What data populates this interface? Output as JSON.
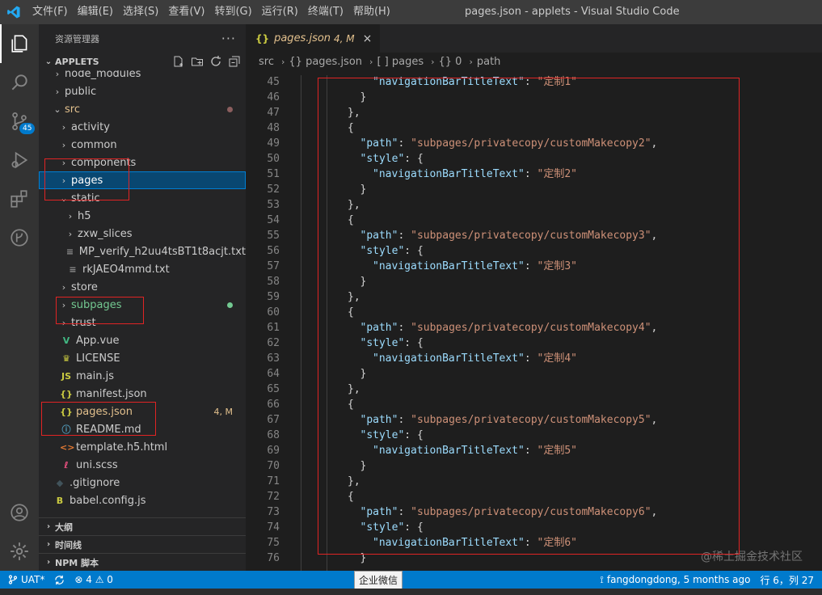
{
  "titlebar": {
    "menu": [
      "文件(F)",
      "编辑(E)",
      "选择(S)",
      "查看(V)",
      "转到(G)",
      "运行(R)",
      "终端(T)",
      "帮助(H)"
    ],
    "window_title": "pages.json - applets - Visual Studio Code"
  },
  "activitybar": {
    "scm_badge": "45"
  },
  "sidebar": {
    "title": "资源管理器",
    "more": "···",
    "project": "APPLETS",
    "tree": [
      {
        "label": "node_modules",
        "twist": "›",
        "icon": "",
        "depth": 1,
        "color": "#cccccc"
      },
      {
        "label": "public",
        "twist": "›",
        "icon": "",
        "depth": 1,
        "color": "#cccccc"
      },
      {
        "label": "src",
        "twist": "⌄",
        "icon": "",
        "depth": 1,
        "color": "#e2c08d",
        "dot": "#8b5e5e"
      },
      {
        "label": "activity",
        "twist": "›",
        "icon": "",
        "depth": 2,
        "color": "#cccccc"
      },
      {
        "label": "common",
        "twist": "›",
        "icon": "",
        "depth": 2,
        "color": "#cccccc"
      },
      {
        "label": "components",
        "twist": "›",
        "icon": "",
        "depth": 2,
        "color": "#cccccc"
      },
      {
        "label": "pages",
        "twist": "›",
        "icon": "",
        "depth": 2,
        "color": "#ffffff",
        "selected": true
      },
      {
        "label": "static",
        "twist": "⌄",
        "icon": "",
        "depth": 2,
        "color": "#cccccc"
      },
      {
        "label": "h5",
        "twist": "›",
        "icon": "",
        "depth": 3,
        "color": "#cccccc"
      },
      {
        "label": "zxw_slices",
        "twist": "›",
        "icon": "",
        "depth": 3,
        "color": "#cccccc"
      },
      {
        "label": "MP_verify_h2uu4tsBT1t8acjt.txt",
        "twist": "",
        "icon": "≡",
        "depth": 3,
        "color": "#cccccc",
        "icolor": "#8f8f8f"
      },
      {
        "label": "rkJAEO4mmd.txt",
        "twist": "",
        "icon": "≡",
        "depth": 3,
        "color": "#cccccc",
        "icolor": "#8f8f8f"
      },
      {
        "label": "store",
        "twist": "›",
        "icon": "",
        "depth": 2,
        "color": "#cccccc"
      },
      {
        "label": "subpages",
        "twist": "›",
        "icon": "",
        "depth": 2,
        "color": "#73c991",
        "dot": "#73c991"
      },
      {
        "label": "trust",
        "twist": "›",
        "icon": "",
        "depth": 2,
        "color": "#cccccc"
      },
      {
        "label": "App.vue",
        "twist": "",
        "icon": "V",
        "depth": 2,
        "color": "#cccccc",
        "icolor": "#41b883"
      },
      {
        "label": "LICENSE",
        "twist": "",
        "icon": "♛",
        "depth": 2,
        "color": "#cccccc",
        "icolor": "#cbcb41"
      },
      {
        "label": "main.js",
        "twist": "",
        "icon": "JS",
        "depth": 2,
        "color": "#cccccc",
        "icolor": "#cbcb41"
      },
      {
        "label": "manifest.json",
        "twist": "",
        "icon": "{}",
        "depth": 2,
        "color": "#cccccc",
        "icolor": "#cbcb41"
      },
      {
        "label": "pages.json",
        "twist": "",
        "icon": "{}",
        "depth": 2,
        "color": "#e2c08d",
        "icolor": "#cbcb41",
        "status": "4, M"
      },
      {
        "label": "README.md",
        "twist": "",
        "icon": "ⓘ",
        "depth": 2,
        "color": "#cccccc",
        "icolor": "#519aba"
      },
      {
        "label": "template.h5.html",
        "twist": "",
        "icon": "<>",
        "depth": 2,
        "color": "#cccccc",
        "icolor": "#e37933"
      },
      {
        "label": "uni.scss",
        "twist": "",
        "icon": "ℓ",
        "depth": 2,
        "color": "#cccccc",
        "icolor": "#f55385"
      },
      {
        "label": ".gitignore",
        "twist": "",
        "icon": "◆",
        "depth": 1,
        "color": "#cccccc",
        "icolor": "#41535b"
      },
      {
        "label": "babel.config.js",
        "twist": "",
        "icon": "B",
        "depth": 1,
        "color": "#cccccc",
        "icolor": "#cbcb41"
      }
    ],
    "bottom_sections": [
      "大纲",
      "时间线",
      "NPM 脚本"
    ]
  },
  "editor": {
    "tab": {
      "icon": "{}",
      "name": "pages.json",
      "mod": "4, M",
      "close": "×"
    },
    "breadcrumb": [
      "src",
      "{} pages.json",
      "[ ] pages",
      "{} 0",
      "path"
    ],
    "lines": [
      {
        "n": "45",
        "indent": 6,
        "parts": [
          [
            "k",
            "\"navigationBarTitleText\""
          ],
          [
            "p",
            ": "
          ],
          [
            "s",
            "\"定制1\""
          ]
        ]
      },
      {
        "n": "46",
        "indent": 5,
        "parts": [
          [
            "p",
            "}"
          ]
        ]
      },
      {
        "n": "47",
        "indent": 4,
        "parts": [
          [
            "p",
            "},"
          ]
        ]
      },
      {
        "n": "48",
        "indent": 4,
        "parts": [
          [
            "p",
            "{"
          ]
        ]
      },
      {
        "n": "49",
        "indent": 5,
        "parts": [
          [
            "k",
            "\"path\""
          ],
          [
            "p",
            ": "
          ],
          [
            "s",
            "\"subpages/privatecopy/customMakecopy2\""
          ],
          [
            "p",
            ","
          ]
        ]
      },
      {
        "n": "50",
        "indent": 5,
        "parts": [
          [
            "k",
            "\"style\""
          ],
          [
            "p",
            ": {"
          ]
        ]
      },
      {
        "n": "51",
        "indent": 6,
        "parts": [
          [
            "k",
            "\"navigationBarTitleText\""
          ],
          [
            "p",
            ": "
          ],
          [
            "s",
            "\"定制2\""
          ]
        ]
      },
      {
        "n": "52",
        "indent": 5,
        "parts": [
          [
            "p",
            "}"
          ]
        ]
      },
      {
        "n": "53",
        "indent": 4,
        "parts": [
          [
            "p",
            "},"
          ]
        ]
      },
      {
        "n": "54",
        "indent": 4,
        "parts": [
          [
            "p",
            "{"
          ]
        ]
      },
      {
        "n": "55",
        "indent": 5,
        "parts": [
          [
            "k",
            "\"path\""
          ],
          [
            "p",
            ": "
          ],
          [
            "s",
            "\"subpages/privatecopy/customMakecopy3\""
          ],
          [
            "p",
            ","
          ]
        ]
      },
      {
        "n": "56",
        "indent": 5,
        "parts": [
          [
            "k",
            "\"style\""
          ],
          [
            "p",
            ": {"
          ]
        ]
      },
      {
        "n": "57",
        "indent": 6,
        "parts": [
          [
            "k",
            "\"navigationBarTitleText\""
          ],
          [
            "p",
            ": "
          ],
          [
            "s",
            "\"定制3\""
          ]
        ]
      },
      {
        "n": "58",
        "indent": 5,
        "parts": [
          [
            "p",
            "}"
          ]
        ]
      },
      {
        "n": "59",
        "indent": 4,
        "parts": [
          [
            "p",
            "},"
          ]
        ]
      },
      {
        "n": "60",
        "indent": 4,
        "parts": [
          [
            "p",
            "{"
          ]
        ]
      },
      {
        "n": "61",
        "indent": 5,
        "parts": [
          [
            "k",
            "\"path\""
          ],
          [
            "p",
            ": "
          ],
          [
            "s",
            "\"subpages/privatecopy/customMakecopy4\""
          ],
          [
            "p",
            ","
          ]
        ]
      },
      {
        "n": "62",
        "indent": 5,
        "parts": [
          [
            "k",
            "\"style\""
          ],
          [
            "p",
            ": {"
          ]
        ]
      },
      {
        "n": "63",
        "indent": 6,
        "parts": [
          [
            "k",
            "\"navigationBarTitleText\""
          ],
          [
            "p",
            ": "
          ],
          [
            "s",
            "\"定制4\""
          ]
        ]
      },
      {
        "n": "64",
        "indent": 5,
        "parts": [
          [
            "p",
            "}"
          ]
        ]
      },
      {
        "n": "65",
        "indent": 4,
        "parts": [
          [
            "p",
            "},"
          ]
        ]
      },
      {
        "n": "66",
        "indent": 4,
        "parts": [
          [
            "p",
            "{"
          ]
        ]
      },
      {
        "n": "67",
        "indent": 5,
        "parts": [
          [
            "k",
            "\"path\""
          ],
          [
            "p",
            ": "
          ],
          [
            "s",
            "\"subpages/privatecopy/customMakecopy5\""
          ],
          [
            "p",
            ","
          ]
        ]
      },
      {
        "n": "68",
        "indent": 5,
        "parts": [
          [
            "k",
            "\"style\""
          ],
          [
            "p",
            ": {"
          ]
        ]
      },
      {
        "n": "69",
        "indent": 6,
        "parts": [
          [
            "k",
            "\"navigationBarTitleText\""
          ],
          [
            "p",
            ": "
          ],
          [
            "s",
            "\"定制5\""
          ]
        ]
      },
      {
        "n": "70",
        "indent": 5,
        "parts": [
          [
            "p",
            "}"
          ]
        ]
      },
      {
        "n": "71",
        "indent": 4,
        "parts": [
          [
            "p",
            "},"
          ]
        ]
      },
      {
        "n": "72",
        "indent": 4,
        "parts": [
          [
            "p",
            "{"
          ]
        ]
      },
      {
        "n": "73",
        "indent": 5,
        "parts": [
          [
            "k",
            "\"path\""
          ],
          [
            "p",
            ": "
          ],
          [
            "s",
            "\"subpages/privatecopy/customMakecopy6\""
          ],
          [
            "p",
            ","
          ]
        ]
      },
      {
        "n": "74",
        "indent": 5,
        "parts": [
          [
            "k",
            "\"style\""
          ],
          [
            "p",
            ": {"
          ]
        ]
      },
      {
        "n": "75",
        "indent": 6,
        "parts": [
          [
            "k",
            "\"navigationBarTitleText\""
          ],
          [
            "p",
            ": "
          ],
          [
            "s",
            "\"定制6\""
          ]
        ]
      },
      {
        "n": "76",
        "indent": 5,
        "parts": [
          [
            "p",
            "}"
          ]
        ]
      }
    ],
    "watermark": "@稀土掘金技术社区"
  },
  "statusbar": {
    "branch": "UAT*",
    "problems": "⊗ 4 ⚠ 0",
    "tooltip": "企业微信",
    "blame": "fangdongdong, 5 months ago",
    "position": "行 6，列 27"
  }
}
